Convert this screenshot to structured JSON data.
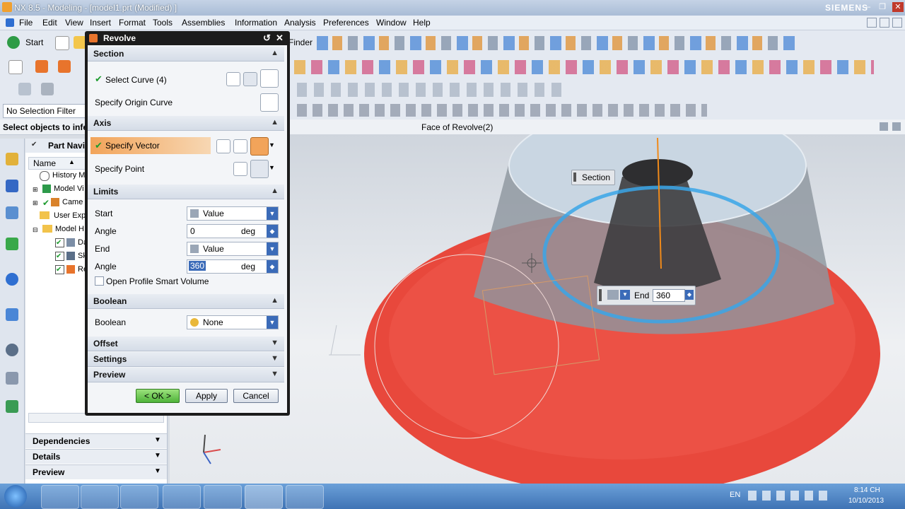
{
  "window": {
    "title": "NX 8.5 - Modeling - [model1.prt (Modified) ]",
    "brand": "SIEMENS"
  },
  "menu": [
    "File",
    "Edit",
    "View",
    "Insert",
    "Format",
    "Tools",
    "Assemblies",
    "Information",
    "Analysis",
    "Preferences",
    "Window",
    "Help"
  ],
  "toolbar": {
    "start_label": "Start",
    "finder_label": "Finder",
    "no_selection_filter": "No Selection Filter",
    "status_prompt": "Select objects to infer",
    "face_label": "Face of Revolve(2)"
  },
  "navigator": {
    "title": "Part Navig",
    "col_name": "Name",
    "items": [
      "History M",
      "Model Vi",
      "Came",
      "User Exp",
      "Model H",
      "Da",
      "Sk",
      "Re"
    ],
    "bottom": [
      "Dependencies",
      "Details",
      "Preview"
    ]
  },
  "dialog": {
    "title": "Revolve",
    "section": {
      "header": "Section",
      "select_curve": "Select Curve (4)",
      "origin_curve": "Specify Origin Curve"
    },
    "axis": {
      "header": "Axis",
      "vector": "Specify Vector",
      "point": "Specify Point"
    },
    "limits": {
      "header": "Limits",
      "start_label": "Start",
      "start_value": "Value",
      "angle1_label": "Angle",
      "angle1_value": "0",
      "angle1_unit": "deg",
      "end_label": "End",
      "end_value": "Value",
      "angle2_label": "Angle",
      "angle2_value": "360",
      "angle2_unit": "deg",
      "open_profile": "Open Profile Smart Volume"
    },
    "boolean": {
      "header": "Boolean",
      "label": "Boolean",
      "value": "None"
    },
    "offset": "Offset",
    "settings": "Settings",
    "preview": "Preview",
    "ok": "< OK >",
    "apply": "Apply",
    "cancel": "Cancel"
  },
  "viewport": {
    "section_tag": "Section",
    "end_label": "End",
    "end_value": "360"
  },
  "tray": {
    "lang": "EN",
    "time": "8:14 CH",
    "date": "10/10/2013"
  },
  "colors": {
    "torus": "#e8483c",
    "ring": "#3aa6e8",
    "accent": "#f2a45a"
  }
}
